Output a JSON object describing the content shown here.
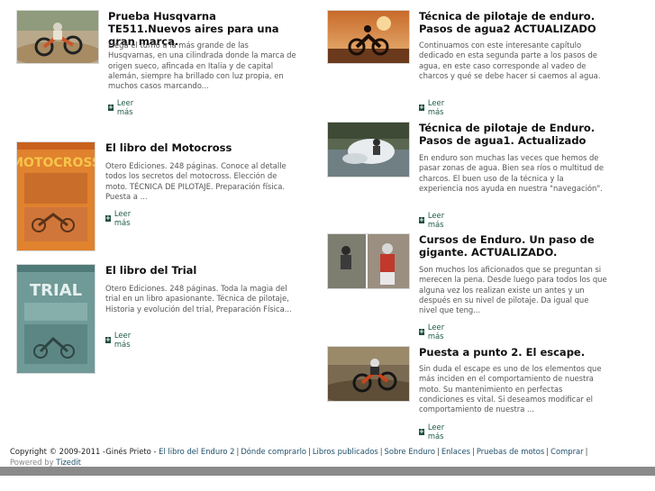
{
  "left_articles": [
    {
      "title": "Prueba Husqvarna TE511.Nuevos aires para una gran marca.",
      "excerpt": "Llega el turno a la más grande de las Husqvarnas, en una cilindrada donde la marca de origen sueco, afincada en Italia y de capital alemán, siempre ha brillado con luz propia, en muchos casos marcando...",
      "read_more": "Leer más",
      "thumb_icon": "motocross-rider-photo"
    },
    {
      "title": "El libro del Motocross",
      "excerpt": "Otero Ediciones. 248 páginas. Conoce al detalle todos los secretos del motocross. Elección de moto. TÉCNICA DE PILOTAJE. Preparación física. Puesta a ...",
      "read_more": "Leer más",
      "thumb_icon": "motocross-book-cover",
      "cover_text": "MOTOCROSS"
    },
    {
      "title": "El libro del Trial",
      "excerpt": "Otero Ediciones. 248 páginas. Toda la magia del trial en un libro apasionante. Técnica de pilotaje, Historia y evolución del trial, Preparación Física...",
      "read_more": "Leer más",
      "thumb_icon": "trial-book-cover",
      "cover_text": "TRIAL"
    }
  ],
  "right_articles": [
    {
      "title": "Técnica de pilotaje de enduro. Pasos de agua2 ACTUALIZADO",
      "excerpt": "Continuamos con este interesante capítulo dedicado en esta segunda parte a los pasos de agua, en este caso corresponde al vadeo de charcos y qué se debe hacer si caemos al agua.",
      "read_more": "Leer más",
      "thumb_icon": "sunset-rider-photo"
    },
    {
      "title": "Técnica de pilotaje de Enduro. Pasos de agua1. Actualizado",
      "excerpt": "En enduro son muchas las veces que hemos de pasar zonas de agua. Bien sea ríos o multitud de charcos. El buen uso de la técnica y la experiencia nos ayuda en nuestra \"navegación\".",
      "read_more": "Leer más",
      "thumb_icon": "water-crossing-photo"
    },
    {
      "title": "Cursos de Enduro. Un paso de gigante. ACTUALIZADO.",
      "excerpt": "Son muchos los aficionados que se preguntan si merecen la pena. Desde luego para todos los que alguna vez los realizan existe un antes y un después en su nivel de pilotaje. Da igual que nivel que teng...",
      "read_more": "Leer más",
      "thumb_icon": "enduro-course-photo"
    },
    {
      "title": "Puesta a punto 2. El escape.",
      "excerpt": "Sin duda el escape es uno de los elementos que más inciden en el comportamiento de nuestra moto. Su mantenimiento en perfectas condiciones es vital. Si deseamos modificar el comportamiento de nuestra ...",
      "read_more": "Leer más",
      "thumb_icon": "offroad-riding-photo"
    }
  ],
  "footer": {
    "copyright": "Copyright © 2009-2011 -Ginés Prieto -",
    "links": [
      "El libro del Enduro 2",
      "Dónde comprarlo",
      "Libros publicados",
      "Sobre Enduro",
      "Enlaces",
      "Pruebas de motos",
      "Comprar"
    ],
    "trailing_sep": "|",
    "powered_by": "Powered by",
    "powered_link": "Tizedit"
  },
  "colors": {
    "link": "#1f4f6a",
    "read_more": "#1f5a4a",
    "bottom_bar": "#8a8a8a"
  }
}
